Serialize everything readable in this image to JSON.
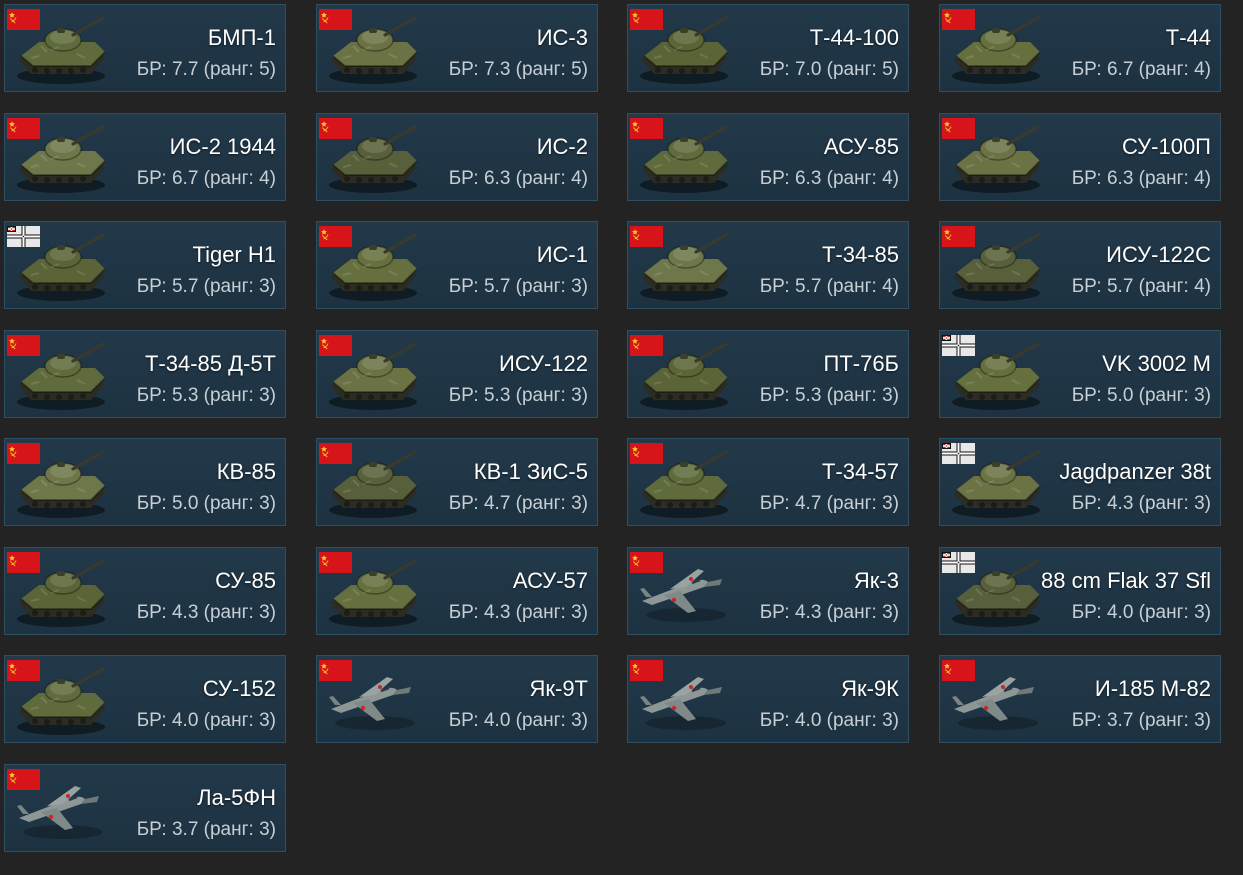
{
  "page": {
    "background": "#232323",
    "card_background": "#1f3545",
    "card_border": "#304e62",
    "name_color": "#ffffff",
    "br_color": "#c7cfd4"
  },
  "vehicles": [
    {
      "name": "БМП-1",
      "br": "БР: 7.7 (ранг: 5)",
      "nation": "ussr",
      "type": "tank",
      "flag_icon": "ussr-flag-icon",
      "vehicle_icon": "tank-icon"
    },
    {
      "name": "ИС-3",
      "br": "БР: 7.3 (ранг: 5)",
      "nation": "ussr",
      "type": "tank",
      "flag_icon": "ussr-flag-icon",
      "vehicle_icon": "tank-icon"
    },
    {
      "name": "Т-44-100",
      "br": "БР: 7.0 (ранг: 5)",
      "nation": "ussr",
      "type": "tank",
      "flag_icon": "ussr-flag-icon",
      "vehicle_icon": "tank-icon"
    },
    {
      "name": "Т-44",
      "br": "БР: 6.7 (ранг: 4)",
      "nation": "ussr",
      "type": "tank",
      "flag_icon": "ussr-flag-icon",
      "vehicle_icon": "tank-icon"
    },
    {
      "name": "ИС-2 1944",
      "br": "БР: 6.7 (ранг: 4)",
      "nation": "ussr",
      "type": "tank",
      "flag_icon": "ussr-flag-icon",
      "vehicle_icon": "tank-icon"
    },
    {
      "name": "ИС-2",
      "br": "БР: 6.3 (ранг: 4)",
      "nation": "ussr",
      "type": "tank",
      "flag_icon": "ussr-flag-icon",
      "vehicle_icon": "tank-icon"
    },
    {
      "name": "АСУ-85",
      "br": "БР: 6.3 (ранг: 4)",
      "nation": "ussr",
      "type": "tank",
      "flag_icon": "ussr-flag-icon",
      "vehicle_icon": "tank-icon"
    },
    {
      "name": "СУ-100П",
      "br": "БР: 6.3 (ранг: 4)",
      "nation": "ussr",
      "type": "tank",
      "flag_icon": "ussr-flag-icon",
      "vehicle_icon": "tank-icon"
    },
    {
      "name": "Tiger H1",
      "br": "БР: 5.7 (ранг: 3)",
      "nation": "germany",
      "type": "tank",
      "flag_icon": "germany-flag-icon",
      "vehicle_icon": "tank-icon"
    },
    {
      "name": "ИС-1",
      "br": "БР: 5.7 (ранг: 3)",
      "nation": "ussr",
      "type": "tank",
      "flag_icon": "ussr-flag-icon",
      "vehicle_icon": "tank-icon"
    },
    {
      "name": "Т-34-85",
      "br": "БР: 5.7 (ранг: 4)",
      "nation": "ussr",
      "type": "tank",
      "flag_icon": "ussr-flag-icon",
      "vehicle_icon": "tank-icon"
    },
    {
      "name": "ИСУ-122С",
      "br": "БР: 5.7 (ранг: 4)",
      "nation": "ussr",
      "type": "tank",
      "flag_icon": "ussr-flag-icon",
      "vehicle_icon": "tank-icon"
    },
    {
      "name": "Т-34-85 Д-5Т",
      "br": "БР: 5.3 (ранг: 3)",
      "nation": "ussr",
      "type": "tank",
      "flag_icon": "ussr-flag-icon",
      "vehicle_icon": "tank-icon"
    },
    {
      "name": "ИСУ-122",
      "br": "БР: 5.3 (ранг: 3)",
      "nation": "ussr",
      "type": "tank",
      "flag_icon": "ussr-flag-icon",
      "vehicle_icon": "tank-icon"
    },
    {
      "name": "ПТ-76Б",
      "br": "БР: 5.3 (ранг: 3)",
      "nation": "ussr",
      "type": "tank",
      "flag_icon": "ussr-flag-icon",
      "vehicle_icon": "tank-icon"
    },
    {
      "name": "VK 3002 M",
      "br": "БР: 5.0 (ранг: 3)",
      "nation": "germany",
      "type": "tank",
      "flag_icon": "germany-flag-icon",
      "vehicle_icon": "tank-icon"
    },
    {
      "name": "КВ-85",
      "br": "БР: 5.0 (ранг: 3)",
      "nation": "ussr",
      "type": "tank",
      "flag_icon": "ussr-flag-icon",
      "vehicle_icon": "tank-icon"
    },
    {
      "name": "КВ-1 ЗиС-5",
      "br": "БР: 4.7 (ранг: 3)",
      "nation": "ussr",
      "type": "tank",
      "flag_icon": "ussr-flag-icon",
      "vehicle_icon": "tank-icon"
    },
    {
      "name": "Т-34-57",
      "br": "БР: 4.7 (ранг: 3)",
      "nation": "ussr",
      "type": "tank",
      "flag_icon": "ussr-flag-icon",
      "vehicle_icon": "tank-icon"
    },
    {
      "name": "Jagdpanzer 38t",
      "br": "БР: 4.3 (ранг: 3)",
      "nation": "germany",
      "type": "tank",
      "flag_icon": "germany-flag-icon",
      "vehicle_icon": "tank-icon"
    },
    {
      "name": "СУ-85",
      "br": "БР: 4.3 (ранг: 3)",
      "nation": "ussr",
      "type": "tank",
      "flag_icon": "ussr-flag-icon",
      "vehicle_icon": "tank-icon"
    },
    {
      "name": "АСУ-57",
      "br": "БР: 4.3 (ранг: 3)",
      "nation": "ussr",
      "type": "tank",
      "flag_icon": "ussr-flag-icon",
      "vehicle_icon": "tank-icon"
    },
    {
      "name": "Як-3",
      "br": "БР: 4.3 (ранг: 3)",
      "nation": "ussr",
      "type": "plane",
      "flag_icon": "ussr-flag-icon",
      "vehicle_icon": "plane-icon"
    },
    {
      "name": "88 cm Flak 37 Sfl",
      "br": "БР: 4.0 (ранг: 3)",
      "nation": "germany",
      "type": "tank",
      "flag_icon": "germany-flag-icon",
      "vehicle_icon": "tank-icon"
    },
    {
      "name": "СУ-152",
      "br": "БР: 4.0 (ранг: 3)",
      "nation": "ussr",
      "type": "tank",
      "flag_icon": "ussr-flag-icon",
      "vehicle_icon": "tank-icon"
    },
    {
      "name": "Як-9Т",
      "br": "БР: 4.0 (ранг: 3)",
      "nation": "ussr",
      "type": "plane",
      "flag_icon": "ussr-flag-icon",
      "vehicle_icon": "plane-icon"
    },
    {
      "name": "Як-9К",
      "br": "БР: 4.0 (ранг: 3)",
      "nation": "ussr",
      "type": "plane",
      "flag_icon": "ussr-flag-icon",
      "vehicle_icon": "plane-icon"
    },
    {
      "name": "И-185 М-82",
      "br": "БР: 3.7 (ранг: 3)",
      "nation": "ussr",
      "type": "plane",
      "flag_icon": "ussr-flag-icon",
      "vehicle_icon": "plane-icon"
    },
    {
      "name": "Ла-5ФН",
      "br": "БР: 3.7 (ранг: 3)",
      "nation": "ussr",
      "type": "plane",
      "flag_icon": "ussr-flag-icon",
      "vehicle_icon": "plane-icon"
    }
  ]
}
